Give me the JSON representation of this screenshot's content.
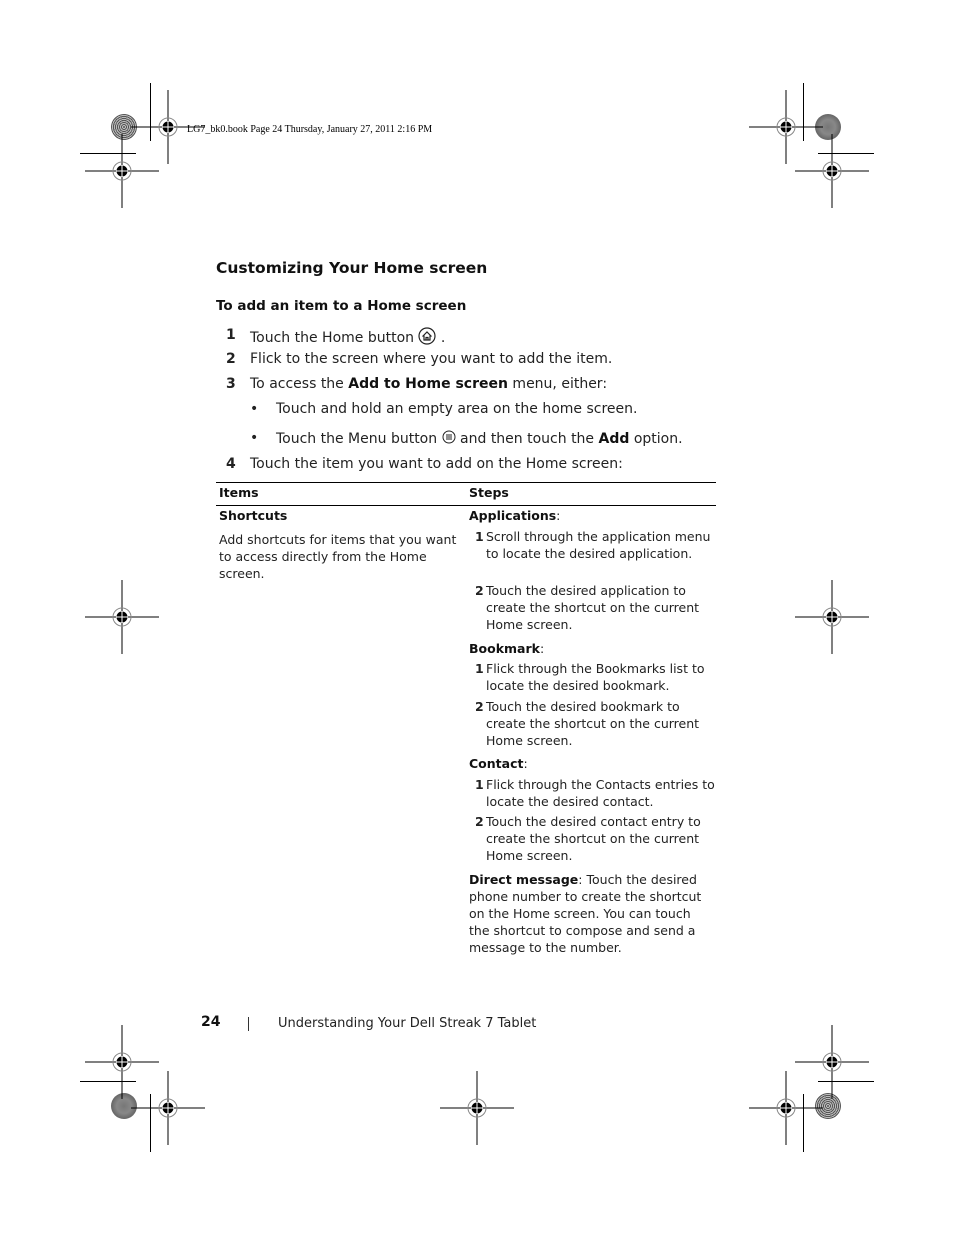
{
  "slug": "LG7_bk0.book  Page 24  Thursday, January 27, 2011  2:16 PM",
  "section_title": "Customizing Your Home screen",
  "subsection_title": "To add an item to a Home screen",
  "steps": [
    {
      "num": "1",
      "text_before": "Touch the Home button ",
      "icon": "home-icon",
      "text_after": " ."
    },
    {
      "num": "2",
      "text": "Flick to the screen where you want to add the item."
    },
    {
      "num": "3",
      "text_before": "To access the ",
      "bold": "Add to Home screen",
      "text_after": " menu, either:"
    },
    {
      "num": "4",
      "text": "Touch the item you want to add on the Home screen:"
    }
  ],
  "bullets": [
    {
      "text": "Touch and hold an empty area on the home screen."
    },
    {
      "text_before": "Touch the Menu button ",
      "icon": "menu-icon",
      "text_mid": " and then touch the ",
      "bold": "Add",
      "text_after": " option."
    }
  ],
  "table": {
    "headers": [
      "Items",
      "Steps"
    ],
    "item_title": "Shortcuts",
    "item_desc": "Add shortcuts for items that you want to access directly from the Home screen.",
    "groups": [
      {
        "title": "Applications",
        "steps": [
          {
            "n": "1",
            "text": "Scroll through the application menu to locate the desired application."
          },
          {
            "n": "2",
            "text": "Touch the desired application to create the shortcut on the current Home screen."
          }
        ]
      },
      {
        "title": "Bookmark",
        "steps": [
          {
            "n": "1",
            "text": "Flick through the Bookmarks list to locate the desired bookmark."
          },
          {
            "n": "2",
            "text": "Touch the desired bookmark to create the shortcut on the current Home screen."
          }
        ]
      },
      {
        "title": "Contact",
        "steps": [
          {
            "n": "1",
            "text": "Flick through the Contacts entries to locate the desired contact."
          },
          {
            "n": "2",
            "text": "Touch the desired contact entry to create the shortcut on the current Home screen."
          }
        ]
      }
    ],
    "direct_message_title": "Direct message",
    "direct_message_text": ": Touch the desired phone number to create the shortcut on the Home screen. You can touch the shortcut to compose and send a message to the number."
  },
  "footer": {
    "page_number": "24",
    "separator": "|",
    "title": "Understanding Your Dell Streak 7 Tablet"
  },
  "colon": ":",
  "bullet_char": "•"
}
